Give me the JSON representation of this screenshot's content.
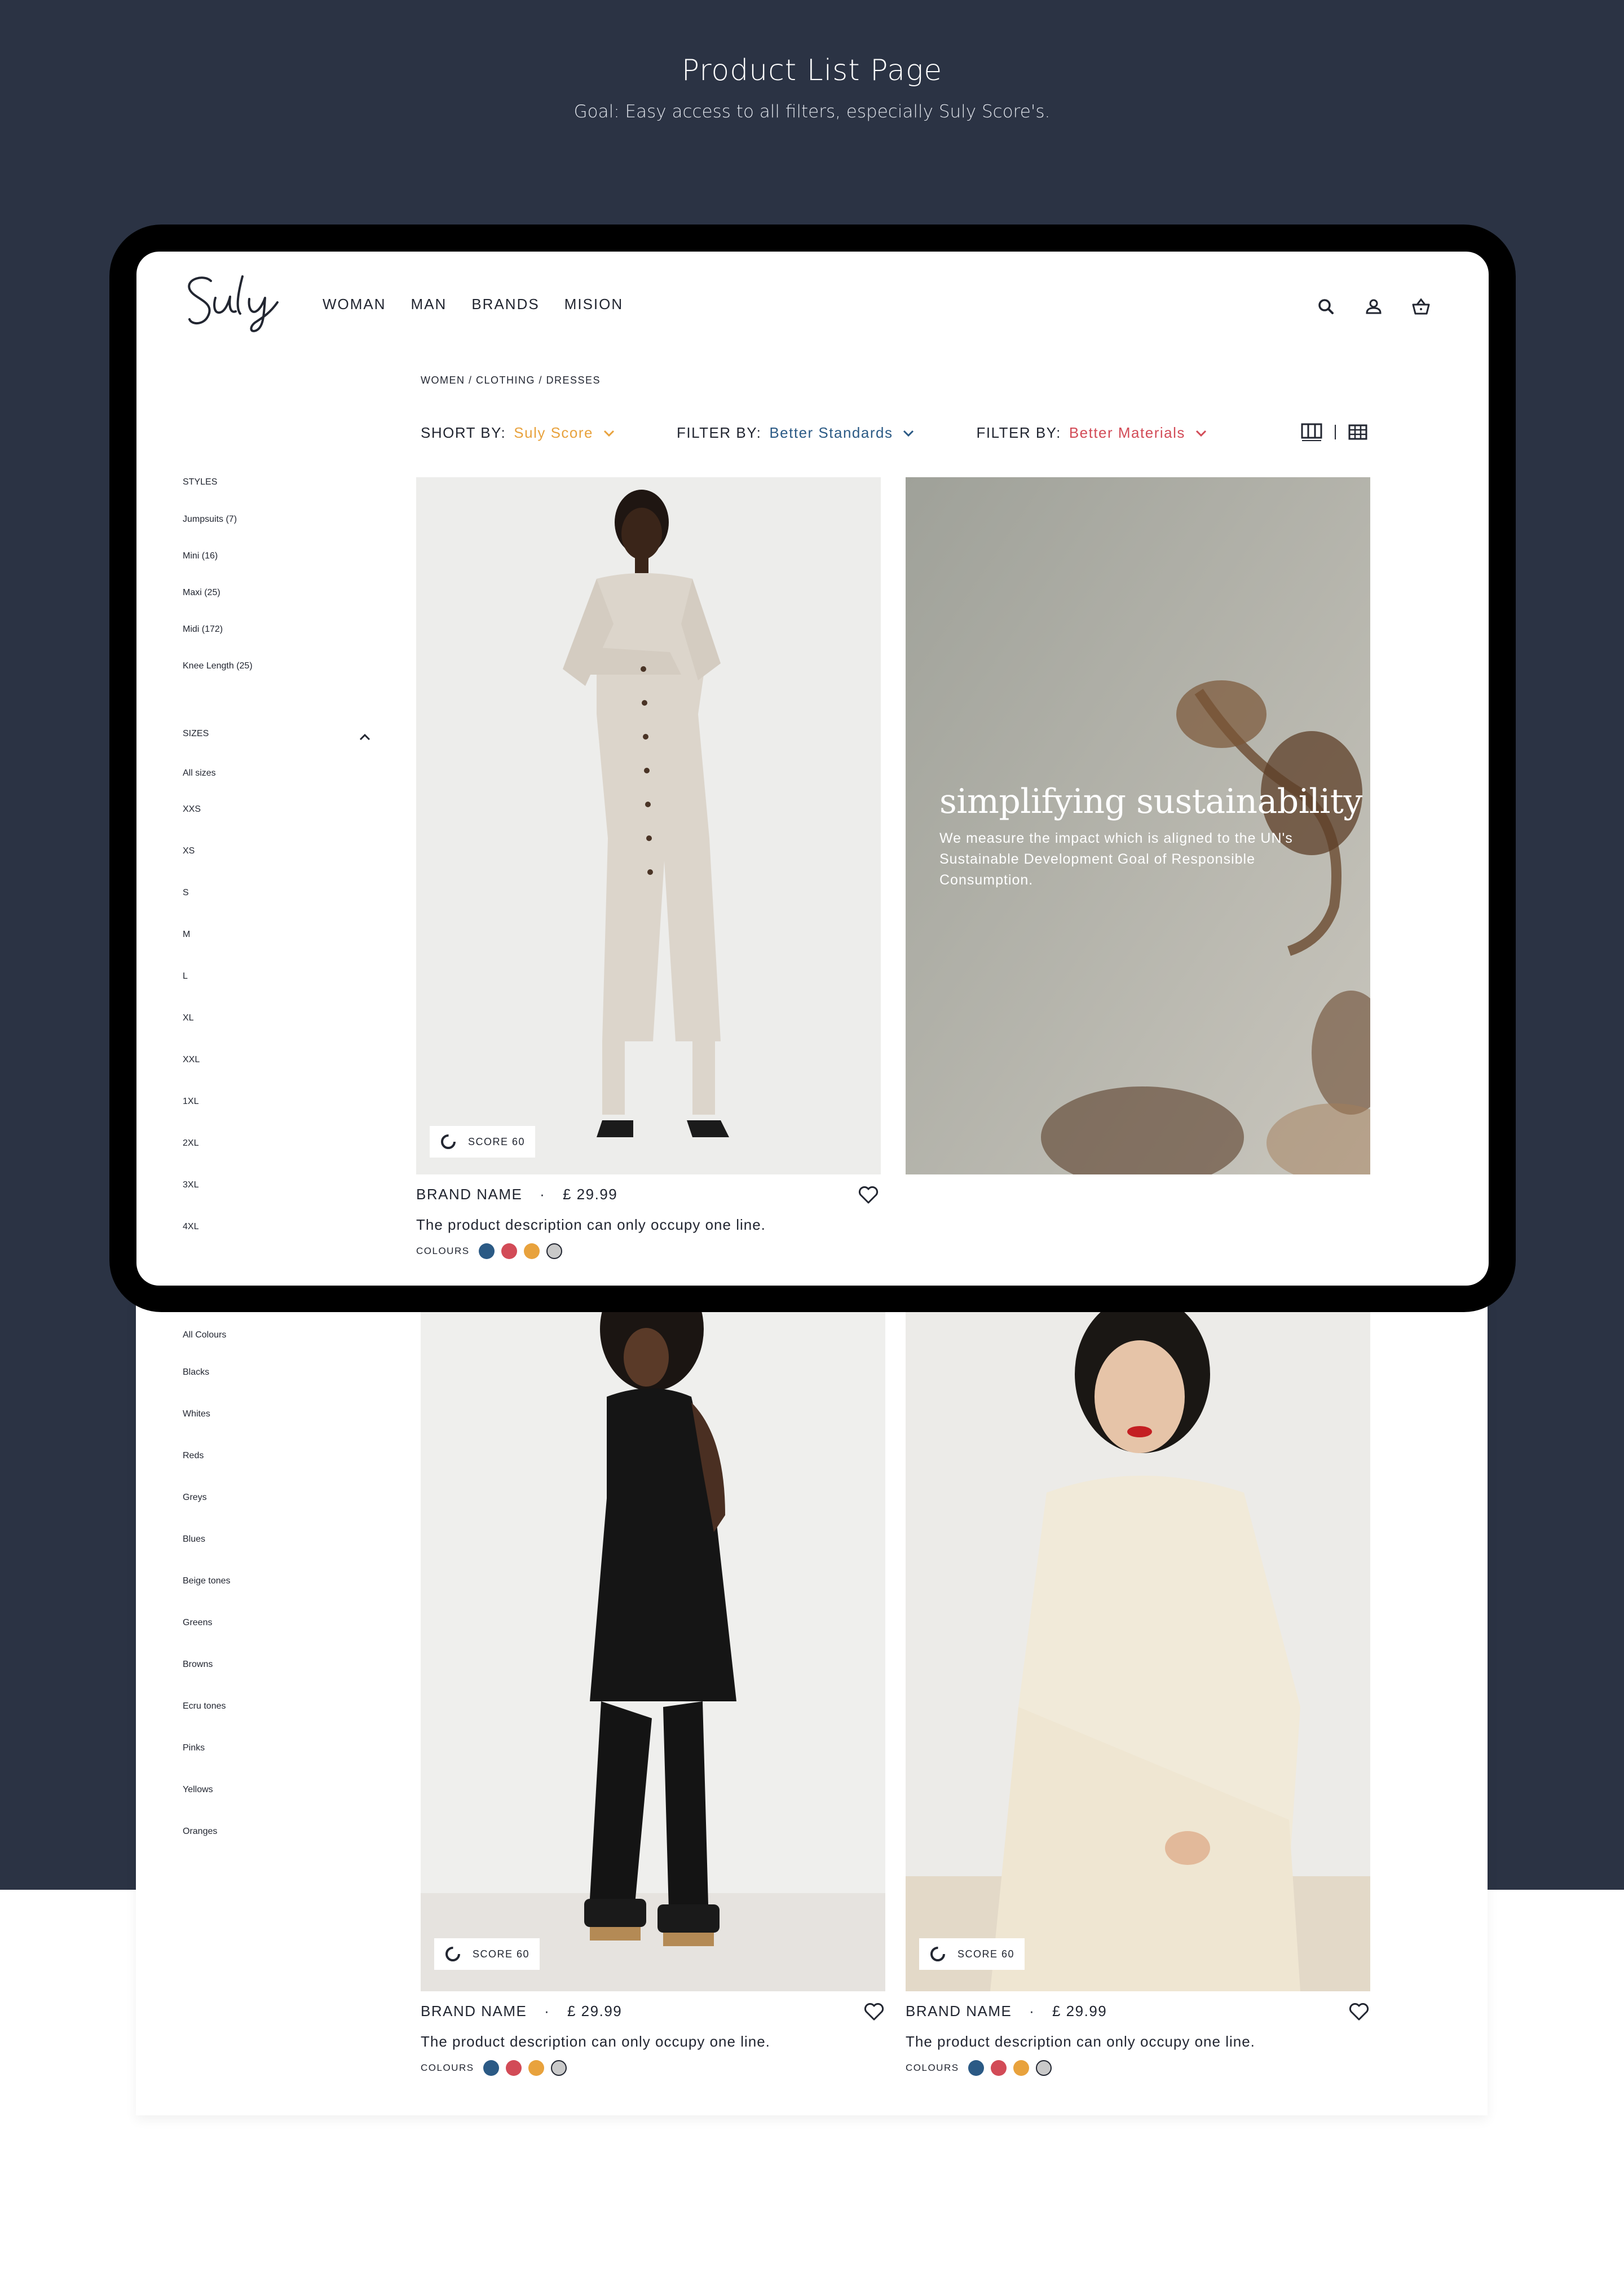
{
  "presentation": {
    "title": "Product List Page",
    "subtitle": "Goal: Easy access to all filters, especially Suly Score's."
  },
  "header": {
    "logo_text": "Suly",
    "nav": [
      "WOMAN",
      "MAN",
      "BRANDS",
      "MISION"
    ],
    "icons": [
      "search-icon",
      "user-icon",
      "basket-icon"
    ]
  },
  "breadcrumb": "WOMEN / CLOTHING / DRESSES",
  "sortbar": {
    "sort": {
      "label": "SHORT BY:",
      "value": "Suly Score",
      "color": "#e8a23d"
    },
    "filter1": {
      "label": "FILTER BY:",
      "value": "Better Standards",
      "color": "#2b5a85"
    },
    "filter2": {
      "label": "FILTER BY:",
      "value": "Better Materials",
      "color": "#d24b57"
    },
    "view_icons": [
      "two-column-grid-icon",
      "multi-column-grid-icon"
    ]
  },
  "sidebar": {
    "styles": {
      "heading": "STYLES",
      "items": [
        "Jumpsuits (7)",
        "Mini (16)",
        "Maxi (25)",
        "Midi (172)",
        "Knee Length (25)"
      ]
    },
    "sizes": {
      "heading": "SIZES",
      "items": [
        "All sizes",
        "XXS",
        "XS",
        "S",
        "M",
        "L",
        "XL",
        "XXL",
        "1XL",
        "2XL",
        "3XL",
        "4XL"
      ]
    },
    "colours": {
      "items": [
        "All Colours",
        "Blacks",
        "Whites",
        "Reds",
        "Greys",
        "Blues",
        "Beige tones",
        "Greens",
        "Browns",
        "Ecru tones",
        "Pinks",
        "Yellows",
        "Oranges"
      ]
    }
  },
  "banner": {
    "heading": "simplifying sustainability",
    "text": "We measure the impact which is aligned to the UN's Sustainable Development Goal of Responsible Consumption."
  },
  "products": [
    {
      "score": "SCORE 60",
      "brand": "BRAND NAME",
      "separator": "·",
      "price": "£ 29.99",
      "description": "The product description can only occupy one line.",
      "colours_label": "COLOURS"
    },
    {
      "score": "SCORE 60",
      "brand": "BRAND NAME",
      "separator": "·",
      "price": "£ 29.99",
      "description": "The product description can only occupy one line.",
      "colours_label": "COLOURS"
    },
    {
      "score": "SCORE 60",
      "brand": "BRAND NAME",
      "separator": "·",
      "price": "£ 29.99",
      "description": "The product description can only occupy one line.",
      "colours_label": "COLOURS"
    }
  ],
  "swatch_colors": [
    "#2b5a85",
    "#d24b57",
    "#e8a23d",
    "#c9c9c9"
  ],
  "colors": {
    "navy": "#2b3344",
    "text": "#222631"
  }
}
